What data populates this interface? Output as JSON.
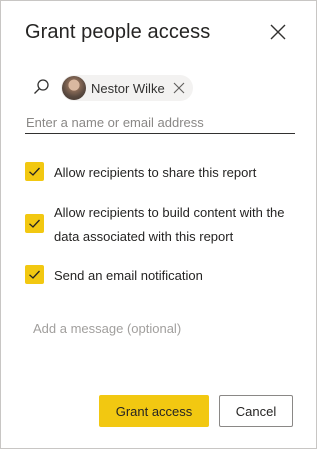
{
  "dialog": {
    "title": "Grant people access",
    "close_icon": "close-icon"
  },
  "recipients": {
    "search_icon": "search-icon",
    "people": [
      {
        "name": "Nestor Wilke"
      }
    ],
    "input_placeholder": "Enter a name or email address"
  },
  "options": [
    {
      "label": "Allow recipients to share this report",
      "checked": true
    },
    {
      "label": "Allow recipients to build content with the data associated with this report",
      "checked": true
    },
    {
      "label": "Send an email notification",
      "checked": true
    }
  ],
  "message": {
    "placeholder": "Add a message (optional)"
  },
  "actions": {
    "primary_label": "Grant access",
    "secondary_label": "Cancel"
  },
  "colors": {
    "accent": "#f2c811",
    "text": "#252423",
    "placeholder": "#8a8886"
  }
}
